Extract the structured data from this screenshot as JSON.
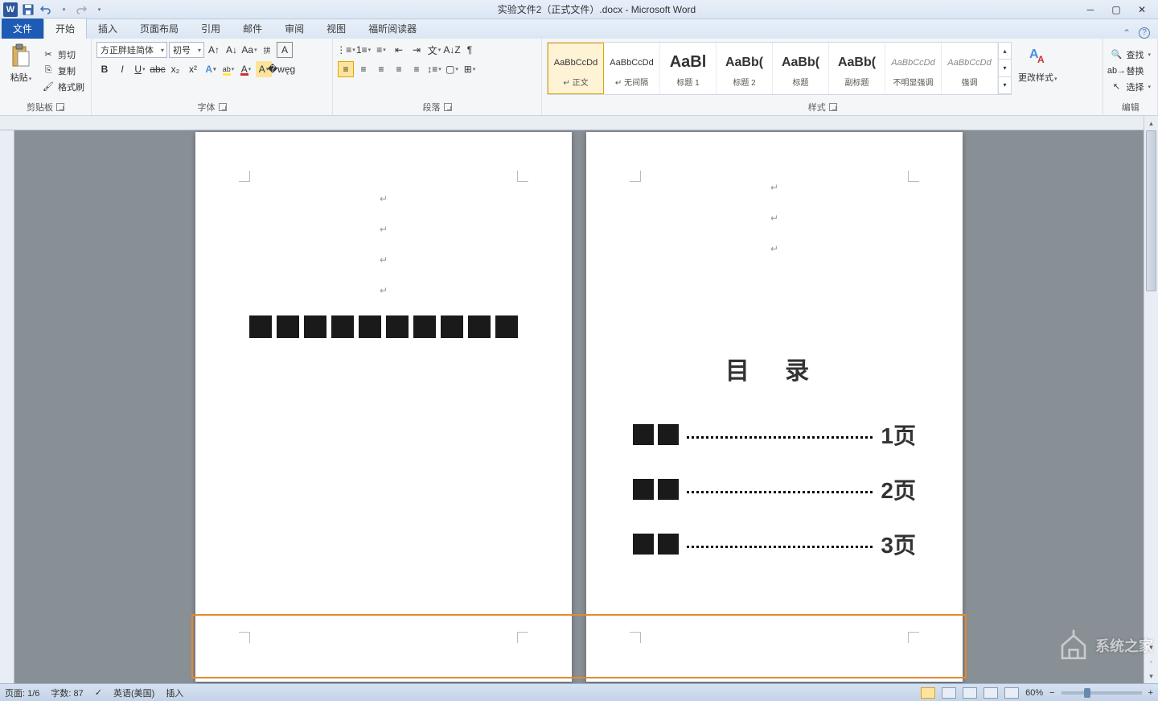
{
  "title": "实验文件2（正式文件）.docx - Microsoft Word",
  "tabs": {
    "file": "文件",
    "items": [
      "开始",
      "插入",
      "页面布局",
      "引用",
      "邮件",
      "审阅",
      "视图",
      "福昕阅读器"
    ],
    "active_index": 0
  },
  "ribbon": {
    "clipboard": {
      "label": "剪贴板",
      "paste": "粘贴",
      "cut": "剪切",
      "copy": "复制",
      "format_painter": "格式刷"
    },
    "font": {
      "label": "字体",
      "name": "方正胖娃简体",
      "size": "初号"
    },
    "paragraph": {
      "label": "段落"
    },
    "styles": {
      "label": "样式",
      "items": [
        {
          "preview": "AaBbCcDd",
          "name": "↵ 正文"
        },
        {
          "preview": "AaBbCcDd",
          "name": "↵ 无间隔"
        },
        {
          "preview": "AaBl",
          "name": "标题 1"
        },
        {
          "preview": "AaBb(",
          "name": "标题 2"
        },
        {
          "preview": "AaBb(",
          "name": "标题"
        },
        {
          "preview": "AaBb(",
          "name": "副标题"
        },
        {
          "preview": "AaBbCcDd",
          "name": "不明显强调"
        },
        {
          "preview": "AaBbCcDd",
          "name": "强调"
        }
      ],
      "change": "更改样式"
    },
    "editing": {
      "label": "编辑",
      "find": "查找",
      "replace": "替换",
      "select": "选择"
    }
  },
  "doc": {
    "toc_title": "目 录",
    "toc": [
      {
        "page": "1页"
      },
      {
        "page": "2页"
      },
      {
        "page": "3页"
      }
    ]
  },
  "status": {
    "page": "页面: 1/6",
    "words": "字数: 87",
    "lang": "英语(美国)",
    "mode": "插入",
    "zoom": "60%"
  },
  "watermark": "系统之家"
}
